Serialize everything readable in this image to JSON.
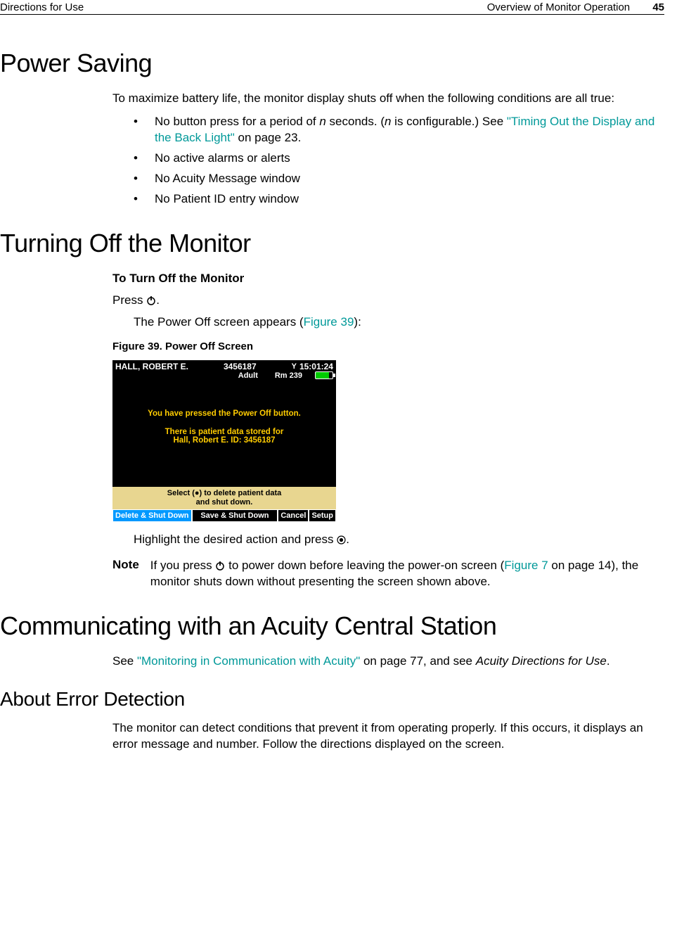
{
  "header": {
    "left": "Directions for Use",
    "right_text": "Overview of Monitor Operation",
    "page_number": "45"
  },
  "section1": {
    "title": "Power Saving",
    "intro": "To maximize battery life, the monitor display shuts off when the following conditions are all true:",
    "bullets": {
      "b1_prefix": "No button press for a period of ",
      "b1_n1": "n",
      "b1_mid": " seconds. (",
      "b1_n2": "n",
      "b1_mid2": " is configurable.) See ",
      "b1_link": "\"Timing Out the Display and the Back Light\"",
      "b1_suffix": " on page 23.",
      "b2": "No active alarms or alerts",
      "b3": "No Acuity Message window",
      "b4": "No Patient ID entry window"
    }
  },
  "section2": {
    "title": "Turning Off the Monitor",
    "sub": "To Turn Off the Monitor",
    "press_prefix": "Press ",
    "press_suffix": ".",
    "result_prefix": "The Power Off screen appears (",
    "result_link": "Figure 39",
    "result_suffix": "):",
    "caption": "Figure 39.  Power Off Screen",
    "highlight_prefix": "Highlight the desired action and press ",
    "highlight_suffix": ".",
    "note_label": "Note",
    "note_prefix": "If you press ",
    "note_mid": " to power down before leaving the power-on screen (",
    "note_link": "Figure 7",
    "note_suffix": " on page 14), the monitor shuts down without presenting the screen shown above."
  },
  "monitor": {
    "patient_name": "HALL, ROBERT E.",
    "patient_id": "3456187",
    "time": "15:01:24",
    "mode": "Adult",
    "room": "Rm 239",
    "body_line1": "You have pressed the Power Off button.",
    "body_line2": "There is patient data stored for",
    "body_line3": "Hall, Robert E. ID: 3456187",
    "prompt_line1": "Select (●) to delete patient data",
    "prompt_line2": "and shut down.",
    "btn_delete": "Delete & Shut Down",
    "btn_save": "Save & Shut Down",
    "btn_cancel": "Cancel",
    "btn_setup": "Setup"
  },
  "section3": {
    "title": "Communicating with an Acuity Central Station",
    "text_prefix": "See ",
    "text_link": "\"Monitoring in Communication with Acuity\"",
    "text_mid": " on page 77, and see ",
    "text_ital": "Acuity Directions for Use",
    "text_suffix": "."
  },
  "section4": {
    "title": "About Error Detection",
    "text": "The monitor can detect conditions that prevent it from operating properly. If this occurs, it displays an error message and number. Follow the directions displayed on the screen."
  }
}
